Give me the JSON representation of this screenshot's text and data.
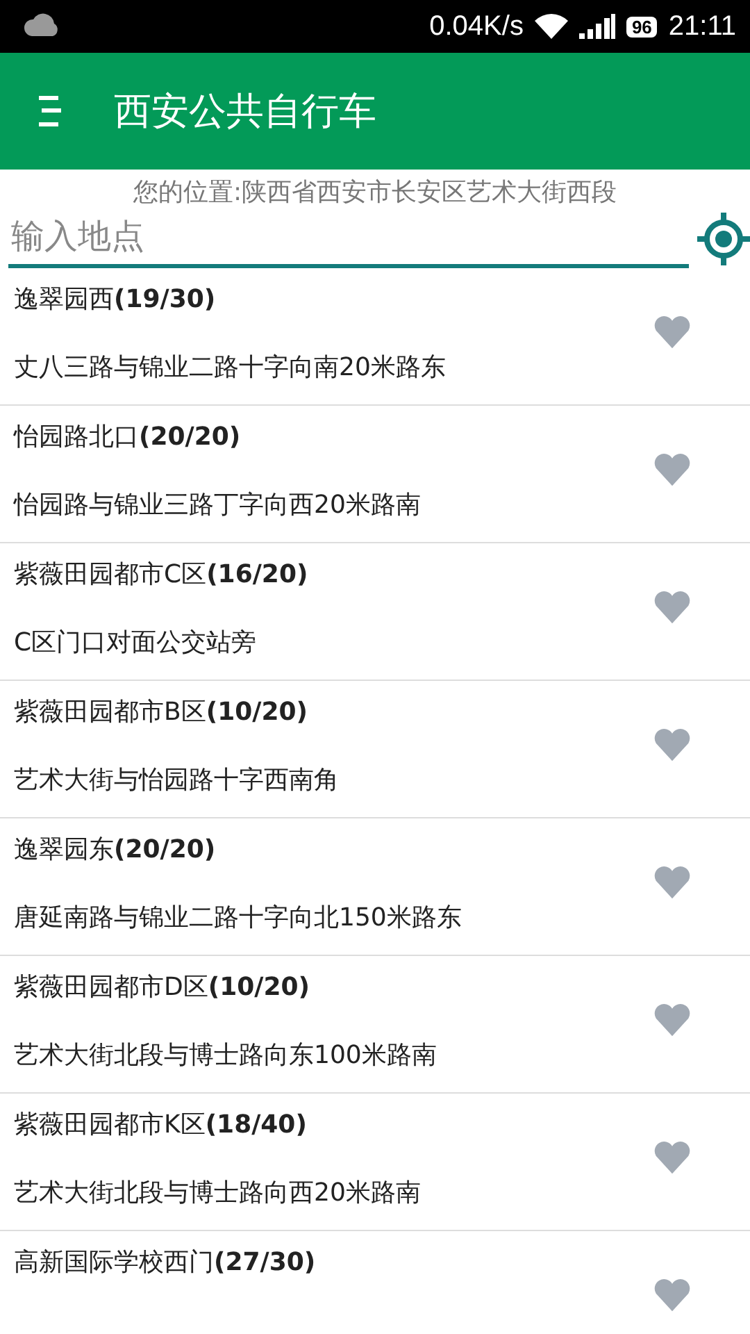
{
  "status_bar": {
    "speed": "0.04K/s",
    "battery": "96",
    "time": "21:11"
  },
  "app_bar": {
    "title": "西安公共自行车"
  },
  "location": "您的位置:陕西省西安市长安区艺术大街西段",
  "search": {
    "placeholder": "输入地点"
  },
  "stations": [
    {
      "name": "逸翠园西**(19/30)**",
      "address": "丈八三路与锦业二路十字向南20米路东"
    },
    {
      "name": "怡园路北口**(20/20)**",
      "address": "怡园路与锦业三路丁字向西20米路南"
    },
    {
      "name": "紫薇田园都市C区**(16/20)**",
      "address": "C区门口对面公交站旁"
    },
    {
      "name": "紫薇田园都市B区**(10/20)**",
      "address": "艺术大街与怡园路十字西南角"
    },
    {
      "name": "逸翠园东**(20/20)**",
      "address": "唐延南路与锦业二路十字向北150米路东"
    },
    {
      "name": "紫薇田园都市D区**(10/20)**",
      "address": "艺术大街北段与博士路向东100米路南"
    },
    {
      "name": "紫薇田园都市K区**(18/40)**",
      "address": "艺术大街北段与博士路向西20米路南"
    },
    {
      "name": "高新国际学校西门**(27/30)**"
    }
  ]
}
